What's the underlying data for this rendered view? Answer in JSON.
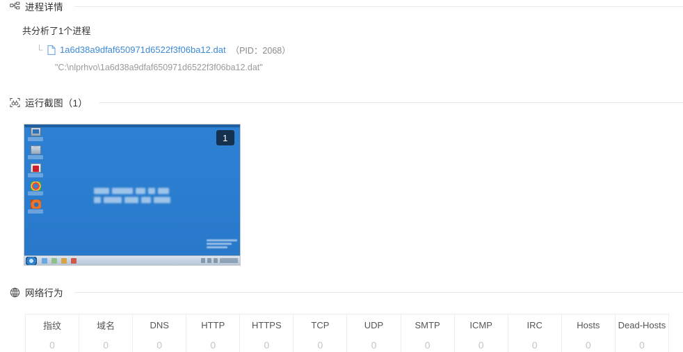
{
  "sections": {
    "process": {
      "icon": "sitemap-icon",
      "title": "进程详情",
      "summary": "共分析了1个进程",
      "tree_elbow": "└",
      "file_icon": "file-icon",
      "process_name": "1a6d38a9dfaf650971d6522f3f06ba12.dat",
      "pid_label": "（PID：2068）",
      "command_line": "\"C:\\nlprhvo\\1a6d38a9dfaf650971d6522f3f06ba12.dat\""
    },
    "screenshots": {
      "icon": "screenshot-icon",
      "title": "运行截图（1）",
      "badge": "1",
      "thumbnail": {
        "alt": "windows-desktop-screenshot",
        "desktop_icons": [
          "computer-icon",
          "recycle-bin-icon",
          "adobe-reader-icon",
          "google-chrome-icon",
          "mozilla-firefox-icon"
        ],
        "taskbar_pins": [
          "ie-pin-icon",
          "explorer-pin-icon",
          "media-player-pin-icon",
          "app-pin-icon"
        ],
        "background_color": "#2d80d2",
        "badge_color": "#16304f"
      }
    },
    "network": {
      "icon": "globe-icon",
      "title": "网络行为",
      "columns": [
        {
          "label": "指纹",
          "value": "0"
        },
        {
          "label": "域名",
          "value": "0"
        },
        {
          "label": "DNS",
          "value": "0"
        },
        {
          "label": "HTTP",
          "value": "0"
        },
        {
          "label": "HTTPS",
          "value": "0"
        },
        {
          "label": "TCP",
          "value": "0"
        },
        {
          "label": "UDP",
          "value": "0"
        },
        {
          "label": "SMTP",
          "value": "0"
        },
        {
          "label": "ICMP",
          "value": "0"
        },
        {
          "label": "IRC",
          "value": "0"
        },
        {
          "label": "Hosts",
          "value": "0"
        },
        {
          "label": "Dead-Hosts",
          "value": "0"
        }
      ]
    }
  },
  "colors": {
    "link": "#3c8ad9",
    "muted": "#9a9a9a",
    "divider": "#e8e8e8",
    "zero_value": "#c4c4c4"
  }
}
